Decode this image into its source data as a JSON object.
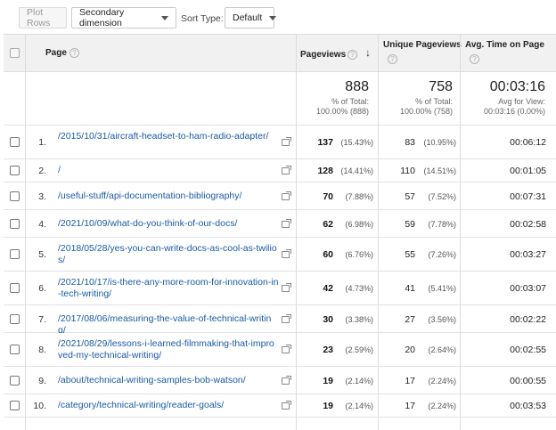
{
  "toolbar": {
    "plot_rows": "Plot Rows",
    "secondary_dimension": "Secondary dimension",
    "sort_type_label": "Sort Type:",
    "sort_type_value": "Default"
  },
  "header": {
    "page": "Page",
    "pageviews": "Pageviews",
    "unique_line1": "Unique Pageviews",
    "avg_time": "Avg. Time on Page",
    "help": "?",
    "sort_arrow": "↓"
  },
  "totals": {
    "pageviews": "888",
    "pageviews_pct": "% of Total:",
    "pageviews_pct_value": "100.00% (888)",
    "unique": "758",
    "unique_pct": "% of Total:",
    "unique_pct_value": "100.00% (758)",
    "avg_time": "00:03:16",
    "avg_label": "Avg for View:",
    "avg_value": "00:03:16 (0.00%)"
  },
  "rows": [
    {
      "index": "1.",
      "page": "/2015/10/31/aircraft-headset-to-ham-radio-adapter/",
      "pageviews": "137",
      "pv_pct": "(15.43%)",
      "unique": "83",
      "u_pct": "(10.95%)",
      "time": "00:06:12"
    },
    {
      "index": "2.",
      "page": "/",
      "pageviews": "128",
      "pv_pct": "(14.41%)",
      "unique": "110",
      "u_pct": "(14.51%)",
      "time": "00:01:05"
    },
    {
      "index": "3.",
      "page": "/useful-stuff/api-documentation-bibliography/",
      "pageviews": "70",
      "pv_pct": "(7.88%)",
      "unique": "57",
      "u_pct": "(7.52%)",
      "time": "00:07:31"
    },
    {
      "index": "4.",
      "page": "/2021/10/09/what-do-you-think-of-our-docs/",
      "pageviews": "62",
      "pv_pct": "(6.98%)",
      "unique": "59",
      "u_pct": "(7.78%)",
      "time": "00:02:58"
    },
    {
      "index": "5.",
      "page": "/2018/05/28/yes-you-can-write-docs-as-cool-as-twilios/",
      "pageviews": "60",
      "pv_pct": "(6.76%)",
      "unique": "55",
      "u_pct": "(7.26%)",
      "time": "00:03:27"
    },
    {
      "index": "6.",
      "page": "/2021/10/17/is-there-any-more-room-for-innovation-in-tech-writing/",
      "pageviews": "42",
      "pv_pct": "(4.73%)",
      "unique": "41",
      "u_pct": "(5.41%)",
      "time": "00:03:07"
    },
    {
      "index": "7.",
      "page": "/2017/08/06/measuring-the-value-of-technical-writing/",
      "pageviews": "30",
      "pv_pct": "(3.38%)",
      "unique": "27",
      "u_pct": "(3.56%)",
      "time": "00:02:22"
    },
    {
      "index": "8.",
      "page": "/2021/08/29/lessons-i-learned-filmmaking-that-improved-my-technical-writing/",
      "pageviews": "23",
      "pv_pct": "(2.59%)",
      "unique": "20",
      "u_pct": "(2.64%)",
      "time": "00:02:55"
    },
    {
      "index": "9.",
      "page": "/about/technical-writing-samples-bob-watson/",
      "pageviews": "19",
      "pv_pct": "(2.14%)",
      "unique": "17",
      "u_pct": "(2.24%)",
      "time": "00:00:55"
    },
    {
      "index": "10.",
      "page": "/category/technical-writing/reader-goals/",
      "pageviews": "19",
      "pv_pct": "(2.14%)",
      "unique": "17",
      "u_pct": "(2.24%)",
      "time": "00:03:53"
    }
  ],
  "colors": {
    "link": "#1a5aa6",
    "header_bg": "#f1f1f1",
    "border": "#dddddd"
  }
}
